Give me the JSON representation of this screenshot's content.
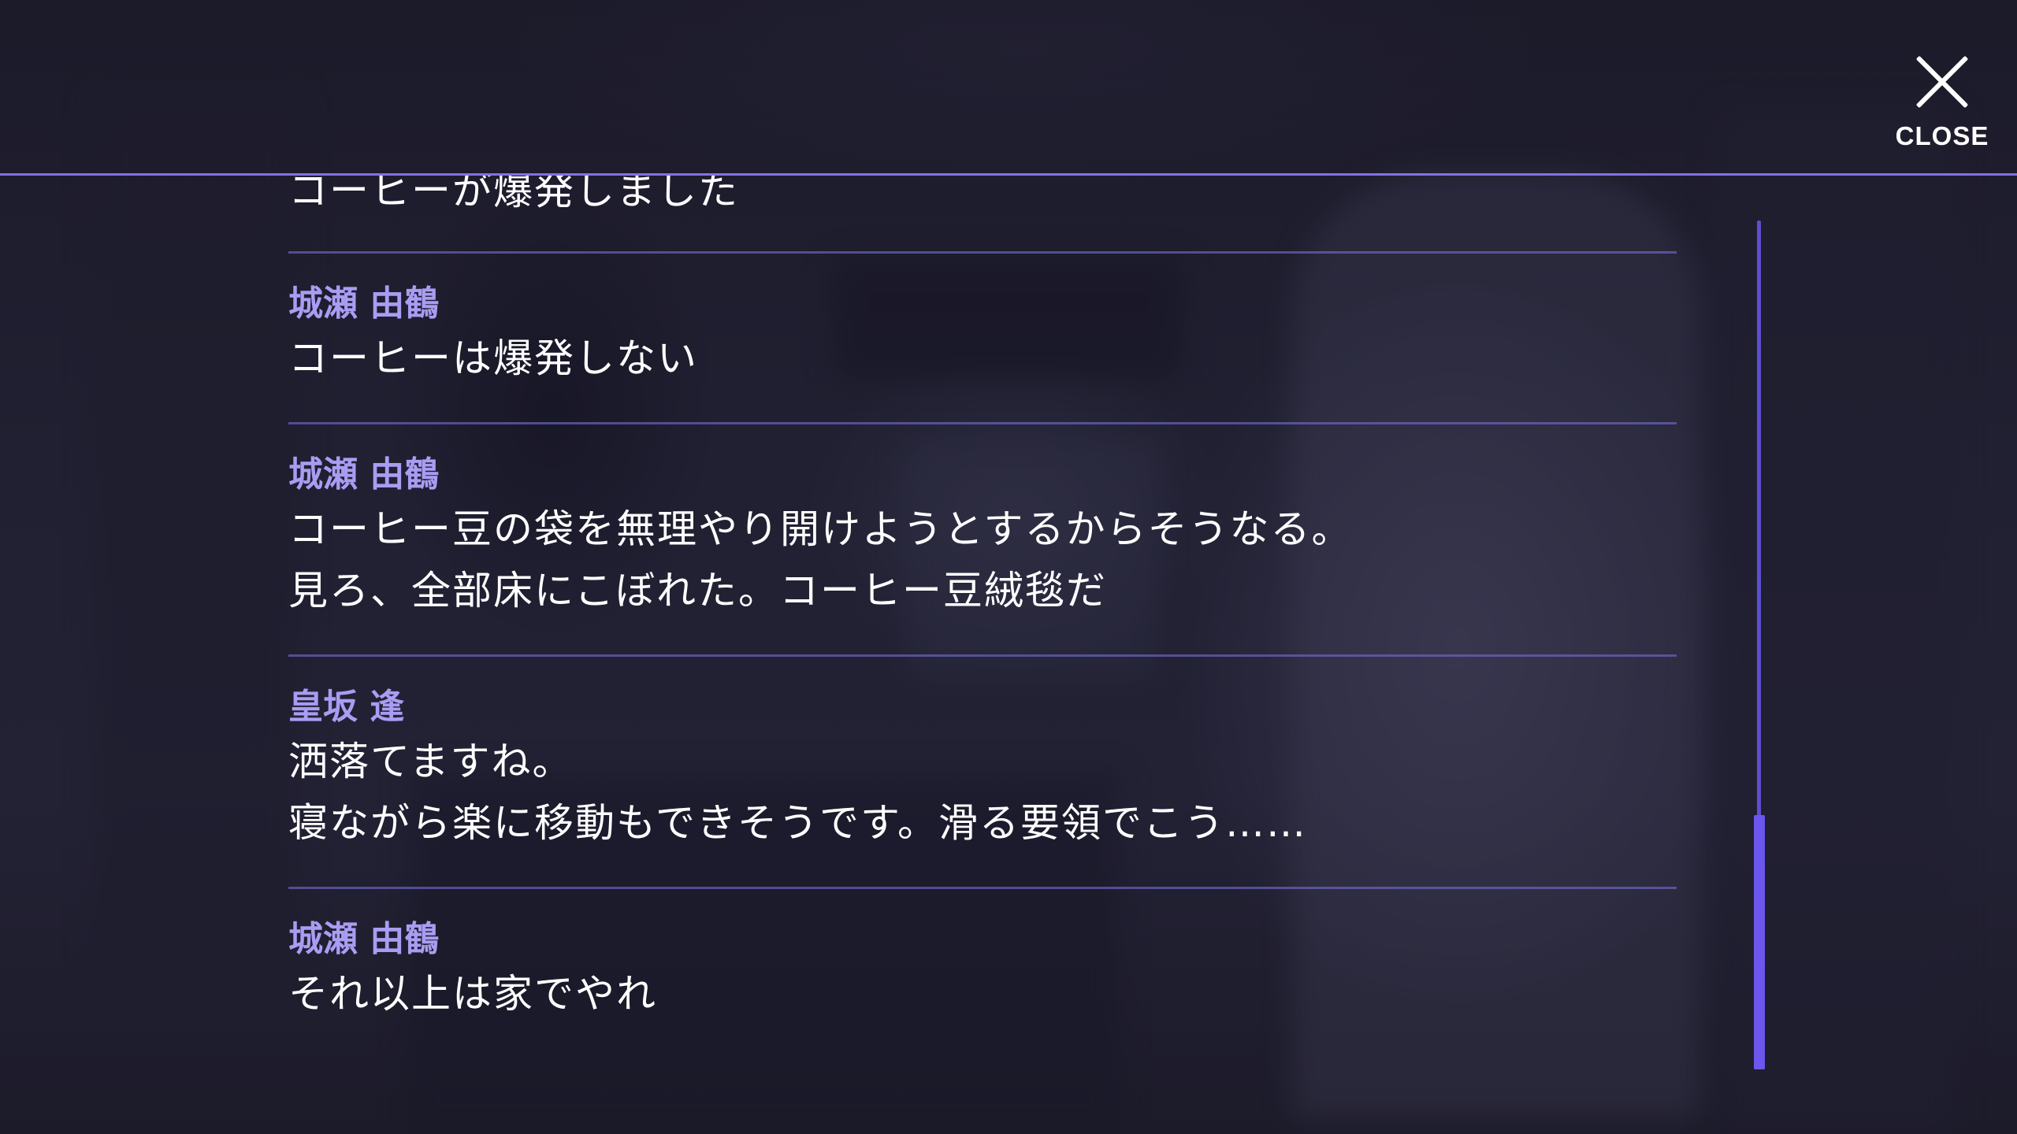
{
  "header": {
    "close_label": "CLOSE"
  },
  "log": {
    "entries": [
      {
        "speaker": "",
        "lines": [
          "コーヒーが爆発しました"
        ]
      },
      {
        "speaker": "城瀬 由鶴",
        "lines": [
          "コーヒーは爆発しない"
        ]
      },
      {
        "speaker": "城瀬 由鶴",
        "lines": [
          "コーヒー豆の袋を無理やり開けようとするからそうなる。",
          "見ろ、全部床にこぼれた。コーヒー豆絨毯だ"
        ]
      },
      {
        "speaker": "皇坂 逢",
        "lines": [
          "洒落てますね。",
          "寝ながら楽に移動もできそうです。滑る要領でこう……"
        ]
      },
      {
        "speaker": "城瀬 由鶴",
        "lines": [
          "それ以上は家でやれ"
        ]
      }
    ]
  },
  "scroll": {
    "position_fraction": 0.7
  },
  "colors": {
    "accent": "#8670e6",
    "speaker": "#a99cf2",
    "text": "#ffffff"
  }
}
